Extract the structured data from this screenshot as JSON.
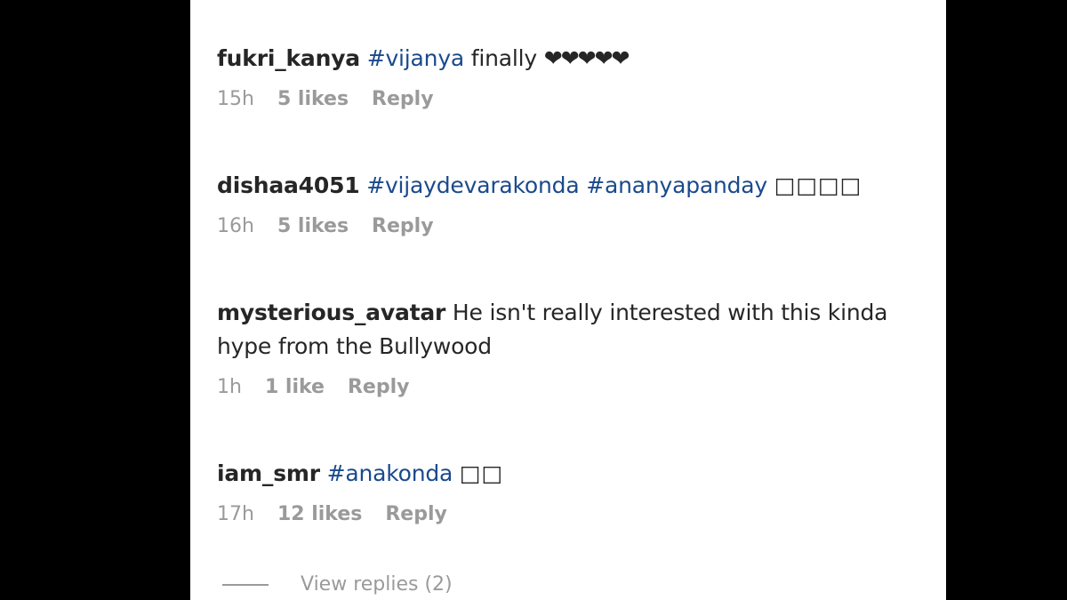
{
  "comments": [
    {
      "username": "fukri_kanya",
      "hashtags": [
        "#vijanya"
      ],
      "text": " finally ",
      "emoji": "❤❤❤❤❤",
      "time": "15h",
      "likes": "5 likes",
      "reply": "Reply"
    },
    {
      "username": "dishaa4051",
      "hashtags": [
        "#vijaydevarakonda",
        "#ananyapanday"
      ],
      "text": "",
      "emoji": "□□□□",
      "time": "16h",
      "likes": "5 likes",
      "reply": "Reply"
    },
    {
      "username": "mysterious_avatar",
      "hashtags": [],
      "text_line1": " He isn't really interested with this kinda",
      "text_line2": "hype from the Bullywood",
      "time": "1h",
      "likes": "1 like",
      "reply": "Reply"
    },
    {
      "username": "iam_smr",
      "hashtags": [
        "#anakonda"
      ],
      "text": " ",
      "emoji": "□□",
      "time": "17h",
      "likes": "12 likes",
      "reply": "Reply"
    }
  ],
  "view_replies": "View replies (2)"
}
